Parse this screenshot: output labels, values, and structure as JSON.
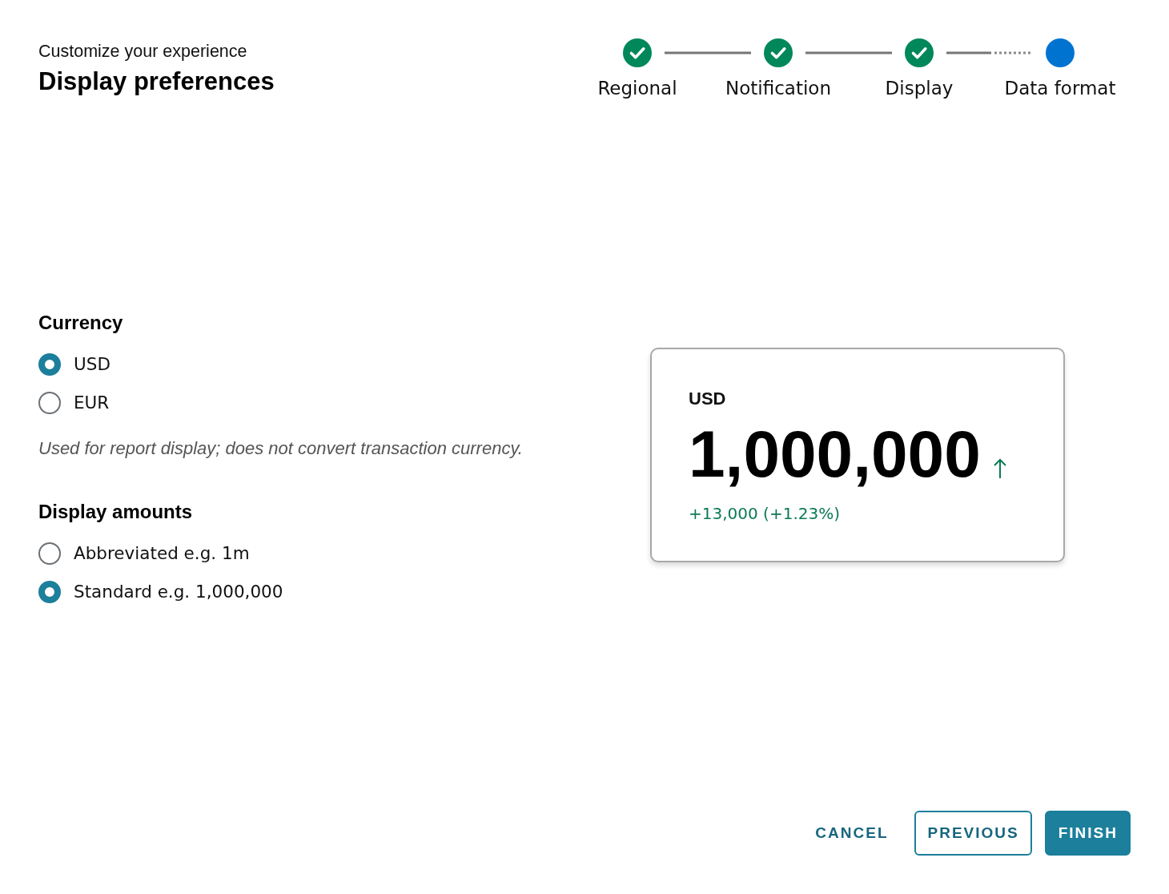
{
  "header": {
    "subtitle": "Customize your experience",
    "title": "Display preferences"
  },
  "steps": [
    {
      "label": "Regional",
      "completed": true,
      "selected": false
    },
    {
      "label": "Notification",
      "completed": true,
      "selected": false
    },
    {
      "label": "Display",
      "completed": true,
      "selected": false
    },
    {
      "label": "Data format",
      "completed": false,
      "selected": true
    }
  ],
  "sections": [
    {
      "heading": "Currency",
      "options": [
        {
          "label": "USD",
          "selected": true
        },
        {
          "label": "EUR",
          "selected": false
        }
      ],
      "hint": "Used for report display; does not convert transaction currency."
    },
    {
      "heading": "Display amounts",
      "options": [
        {
          "label": "Abbreviated e.g. 1m",
          "selected": false
        },
        {
          "label": "Standard e.g. 1,000,000",
          "selected": true
        }
      ]
    }
  ],
  "preview": {
    "currency": "USD",
    "amount": "1,000,000",
    "rising": true,
    "change": "+13,000 (+1.23%)"
  },
  "buttons": [
    {
      "label": "CANCEL",
      "kind": "text"
    },
    {
      "label": "PREVIOUS",
      "kind": "outline"
    },
    {
      "label": "FINISH",
      "kind": "primary"
    }
  ]
}
